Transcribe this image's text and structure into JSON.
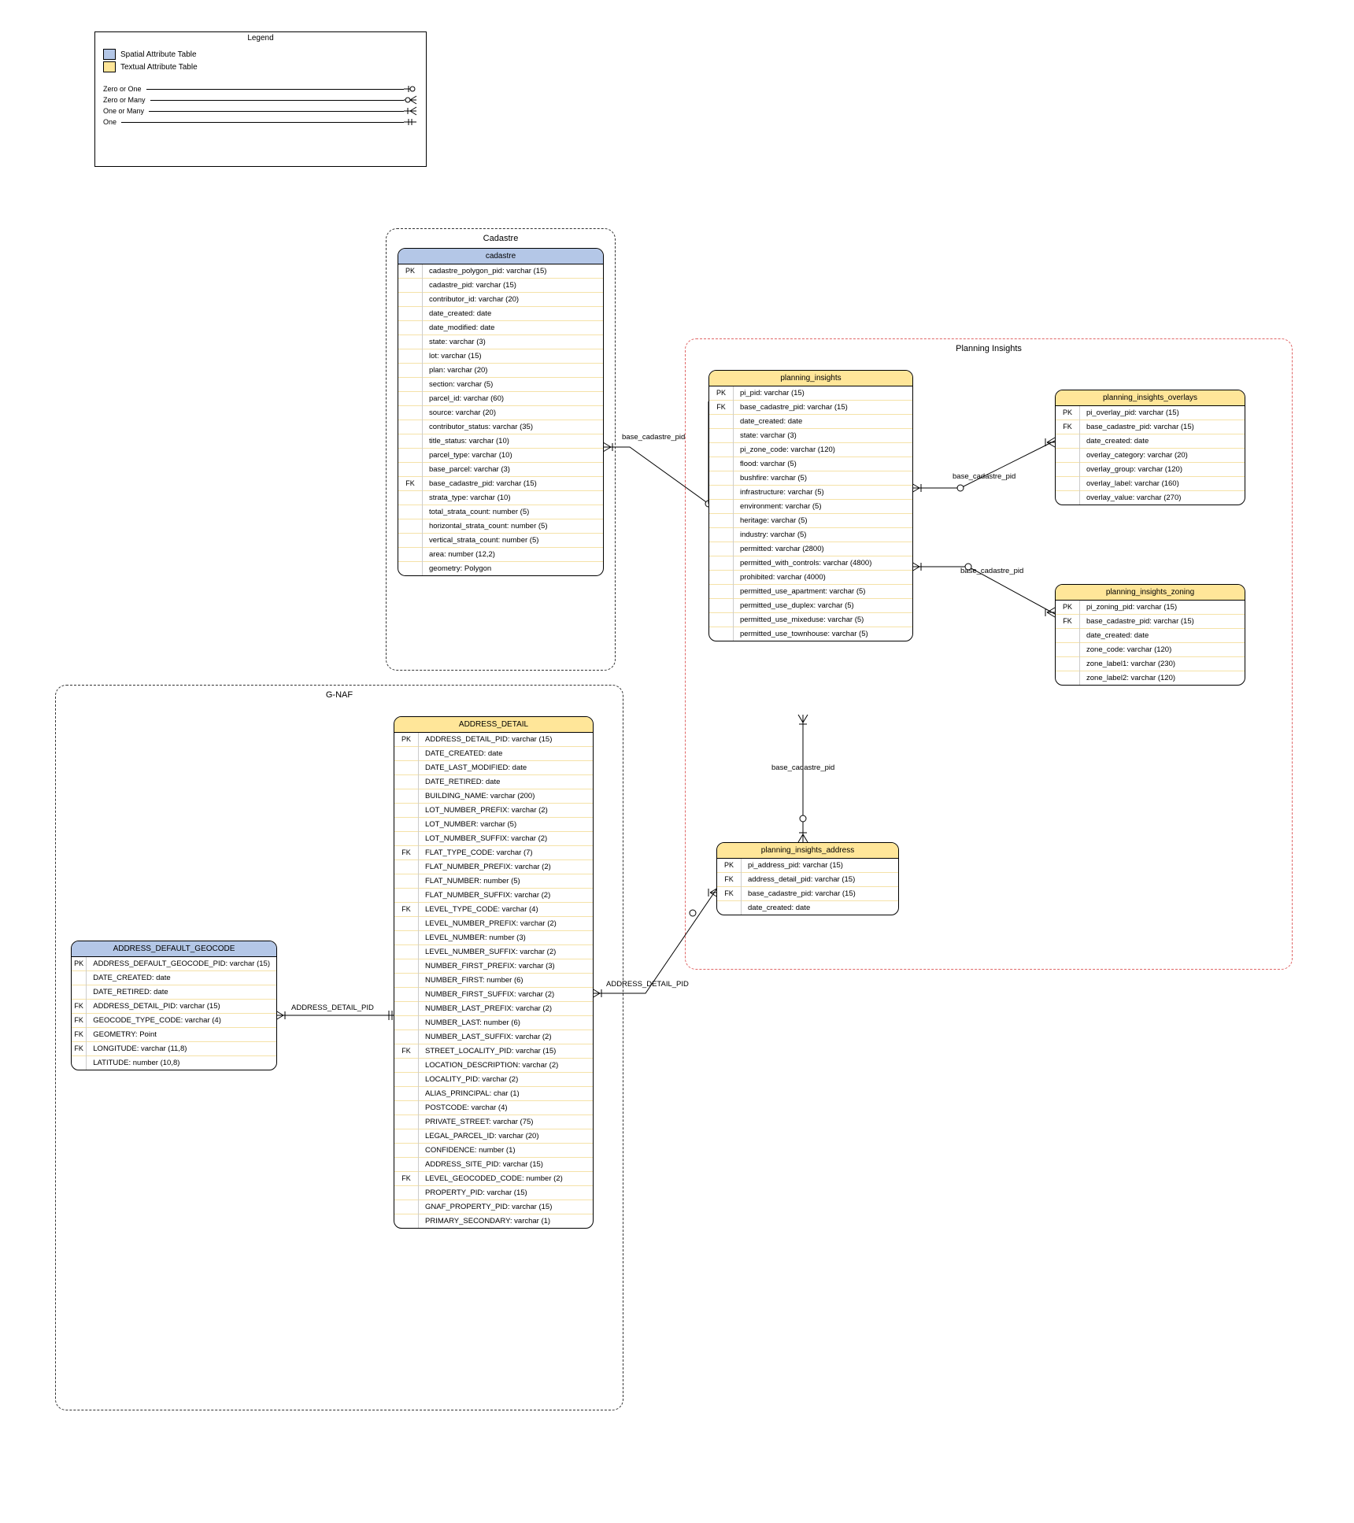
{
  "legend": {
    "title": "Legend",
    "spatial": "Spatial Attribute Table",
    "textual": "Textual Attribute Table",
    "crow": {
      "zero_one": "Zero or One",
      "zero_many": "Zero or Many",
      "one_many": "One or Many",
      "one": "One"
    }
  },
  "groups": {
    "cadastre": "Cadastre",
    "gnaf": "G-NAF",
    "planning": "Planning Insights"
  },
  "entities": {
    "cadastre": {
      "title": "cadastre",
      "rows": [
        {
          "k": "PK",
          "v": "cadastre_polygon_pid: varchar (15)"
        },
        {
          "k": "",
          "v": "cadastre_pid: varchar (15)"
        },
        {
          "k": "",
          "v": "contributor_id: varchar (20)"
        },
        {
          "k": "",
          "v": "date_created: date"
        },
        {
          "k": "",
          "v": "date_modified: date"
        },
        {
          "k": "",
          "v": "state: varchar (3)"
        },
        {
          "k": "",
          "v": "lot: varchar (15)"
        },
        {
          "k": "",
          "v": "plan: varchar (20)"
        },
        {
          "k": "",
          "v": "section: varchar (5)"
        },
        {
          "k": "",
          "v": "parcel_id: varchar (60)"
        },
        {
          "k": "",
          "v": "source: varchar (20)"
        },
        {
          "k": "",
          "v": "contributor_status: varchar (35)"
        },
        {
          "k": "",
          "v": "title_status: varchar (10)"
        },
        {
          "k": "",
          "v": "parcel_type: varchar (10)"
        },
        {
          "k": "",
          "v": "base_parcel: varchar (3)"
        },
        {
          "k": "FK",
          "v": "base_cadastre_pid: varchar (15)"
        },
        {
          "k": "",
          "v": "strata_type: varchar (10)"
        },
        {
          "k": "",
          "v": "total_strata_count: number (5)"
        },
        {
          "k": "",
          "v": "horizontal_strata_count: number (5)"
        },
        {
          "k": "",
          "v": "vertical_strata_count: number (5)"
        },
        {
          "k": "",
          "v": "area: number (12,2)"
        },
        {
          "k": "",
          "v": "geometry: Polygon"
        }
      ]
    },
    "planning_insights": {
      "title": "planning_insights",
      "rows": [
        {
          "k": "PK",
          "v": "pi_pid: varchar (15)"
        },
        {
          "k": "FK",
          "v": "base_cadastre_pid: varchar (15)"
        },
        {
          "k": "",
          "v": "date_created: date"
        },
        {
          "k": "",
          "v": "state: varchar (3)"
        },
        {
          "k": "",
          "v": "pi_zone_code: varchar (120)"
        },
        {
          "k": "",
          "v": "flood: varchar (5)"
        },
        {
          "k": "",
          "v": "bushfire: varchar (5)"
        },
        {
          "k": "",
          "v": "infrastructure: varchar (5)"
        },
        {
          "k": "",
          "v": "environment: varchar (5)"
        },
        {
          "k": "",
          "v": "heritage: varchar (5)"
        },
        {
          "k": "",
          "v": "industry: varchar (5)"
        },
        {
          "k": "",
          "v": "permitted: varchar (2800)"
        },
        {
          "k": "",
          "v": "permitted_with_controls: varchar (4800)"
        },
        {
          "k": "",
          "v": "prohibited: varchar (4000)"
        },
        {
          "k": "",
          "v": "permitted_use_apartment: varchar (5)"
        },
        {
          "k": "",
          "v": "permitted_use_duplex: varchar (5)"
        },
        {
          "k": "",
          "v": "permitted_use_mixeduse: varchar (5)"
        },
        {
          "k": "",
          "v": "permitted_use_townhouse: varchar (5)"
        }
      ]
    },
    "planning_insights_overlays": {
      "title": "planning_insights_overlays",
      "rows": [
        {
          "k": "PK",
          "v": "pi_overlay_pid: varchar (15)"
        },
        {
          "k": "FK",
          "v": "base_cadastre_pid: varchar (15)"
        },
        {
          "k": "",
          "v": "date_created: date"
        },
        {
          "k": "",
          "v": "overlay_category: varchar (20)"
        },
        {
          "k": "",
          "v": "overlay_group: varchar (120)"
        },
        {
          "k": "",
          "v": "overlay_label: varchar (160)"
        },
        {
          "k": "",
          "v": "overlay_value: varchar (270)"
        }
      ]
    },
    "planning_insights_zoning": {
      "title": "planning_insights_zoning",
      "rows": [
        {
          "k": "PK",
          "v": "pi_zoning_pid: varchar (15)"
        },
        {
          "k": "FK",
          "v": "base_cadastre_pid: varchar (15)"
        },
        {
          "k": "",
          "v": "date_created: date"
        },
        {
          "k": "",
          "v": "zone_code: varchar (120)"
        },
        {
          "k": "",
          "v": "zone_label1: varchar (230)"
        },
        {
          "k": "",
          "v": "zone_label2: varchar (120)"
        }
      ]
    },
    "planning_insights_address": {
      "title": "planning_insights_address",
      "rows": [
        {
          "k": "PK",
          "v": "pi_address_pid: varchar (15)"
        },
        {
          "k": "FK",
          "v": "address_detail_pid: varchar (15)"
        },
        {
          "k": "FK",
          "v": "base_cadastre_pid: varchar (15)"
        },
        {
          "k": "",
          "v": "date_created: date"
        }
      ]
    },
    "address_detail": {
      "title": "ADDRESS_DETAIL",
      "rows": [
        {
          "k": "PK",
          "v": "ADDRESS_DETAIL_PID: varchar (15)"
        },
        {
          "k": "",
          "v": "DATE_CREATED: date"
        },
        {
          "k": "",
          "v": "DATE_LAST_MODIFIED: date"
        },
        {
          "k": "",
          "v": "DATE_RETIRED: date"
        },
        {
          "k": "",
          "v": "BUILDING_NAME: varchar (200)"
        },
        {
          "k": "",
          "v": "LOT_NUMBER_PREFIX: varchar (2)"
        },
        {
          "k": "",
          "v": "LOT_NUMBER: varchar (5)"
        },
        {
          "k": "",
          "v": "LOT_NUMBER_SUFFIX: varchar (2)"
        },
        {
          "k": "FK",
          "v": "FLAT_TYPE_CODE: varchar (7)"
        },
        {
          "k": "",
          "v": "FLAT_NUMBER_PREFIX: varchar (2)"
        },
        {
          "k": "",
          "v": "FLAT_NUMBER: number (5)"
        },
        {
          "k": "",
          "v": "FLAT_NUMBER_SUFFIX: varchar (2)"
        },
        {
          "k": "FK",
          "v": "LEVEL_TYPE_CODE: varchar (4)"
        },
        {
          "k": "",
          "v": "LEVEL_NUMBER_PREFIX: varchar (2)"
        },
        {
          "k": "",
          "v": "LEVEL_NUMBER: number (3)"
        },
        {
          "k": "",
          "v": "LEVEL_NUMBER_SUFFIX: varchar (2)"
        },
        {
          "k": "",
          "v": "NUMBER_FIRST_PREFIX: varchar (3)"
        },
        {
          "k": "",
          "v": "NUMBER_FIRST: number (6)"
        },
        {
          "k": "",
          "v": "NUMBER_FIRST_SUFFIX: varchar (2)"
        },
        {
          "k": "",
          "v": "NUMBER_LAST_PREFIX: varchar (2)"
        },
        {
          "k": "",
          "v": "NUMBER_LAST: number (6)"
        },
        {
          "k": "",
          "v": "NUMBER_LAST_SUFFIX: varchar (2)"
        },
        {
          "k": "FK",
          "v": "STREET_LOCALITY_PID: varchar (15)"
        },
        {
          "k": "",
          "v": "LOCATION_DESCRIPTION: varchar (2)"
        },
        {
          "k": "",
          "v": "LOCALITY_PID: varchar (2)"
        },
        {
          "k": "",
          "v": "ALIAS_PRINCIPAL: char (1)"
        },
        {
          "k": "",
          "v": "POSTCODE: varchar (4)"
        },
        {
          "k": "",
          "v": "PRIVATE_STREET: varchar (75)"
        },
        {
          "k": "",
          "v": "LEGAL_PARCEL_ID: varchar (20)"
        },
        {
          "k": "",
          "v": "CONFIDENCE: number (1)"
        },
        {
          "k": "",
          "v": "ADDRESS_SITE_PID: varchar (15)"
        },
        {
          "k": "FK",
          "v": "LEVEL_GEOCODED_CODE: number (2)"
        },
        {
          "k": "",
          "v": "PROPERTY_PID: varchar (15)"
        },
        {
          "k": "",
          "v": "GNAF_PROPERTY_PID: varchar (15)"
        },
        {
          "k": "",
          "v": "PRIMARY_SECONDARY: varchar (1)"
        }
      ]
    },
    "address_default_geocode": {
      "title": "ADDRESS_DEFAULT_GEOCODE",
      "rows": [
        {
          "k": "PK",
          "v": "ADDRESS_DEFAULT_GEOCODE_PID: varchar (15)"
        },
        {
          "k": "",
          "v": "DATE_CREATED: date"
        },
        {
          "k": "",
          "v": "DATE_RETIRED: date"
        },
        {
          "k": "FK",
          "v": "ADDRESS_DETAIL_PID: varchar (15)"
        },
        {
          "k": "FK",
          "v": "GEOCODE_TYPE_CODE: varchar (4)"
        },
        {
          "k": "FK",
          "v": "GEOMETRY: Point"
        },
        {
          "k": "FK",
          "v": "LONGITUDE: varchar (11,8)"
        },
        {
          "k": "",
          "v": "LATITUDE: number (10,8)"
        }
      ]
    }
  },
  "labels": {
    "bc1": "base_cadastre_pid",
    "bc2": "base_cadastre_pid",
    "bc3": "base_cadastre_pid",
    "bc4": "base_cadastre_pid",
    "adp1": "ADDRESS_DETAIL_PID",
    "adp2": "ADDRESS_DETAIL_PID"
  }
}
